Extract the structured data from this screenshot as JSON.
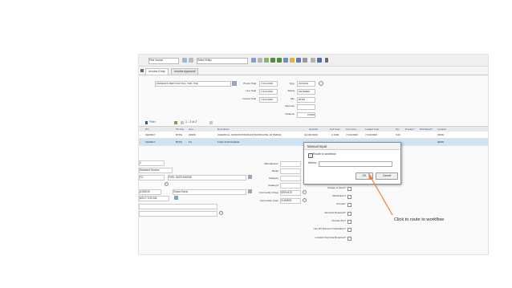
{
  "toolbar": {
    "record_selector_placeholder": "Find Invoice",
    "second_selector_placeholder": "Select Entity"
  },
  "tabs": [
    {
      "label": "Invoice Entry"
    },
    {
      "label": "Invoice Approval"
    }
  ],
  "header": {
    "vendor_name": "PAXMAN'S MRP FOR TDA, TDB, TDE",
    "pretax_total_label": "Pretax Total",
    "pretax_total": "7,612.0000",
    "line_total_label": "Line Total",
    "line_total": "7,612.0000",
    "invoice_total_label": "Invoice Total",
    "invoice_total": "7,612.0000",
    "type_label": "Type",
    "type_value": "INVOICE",
    "status_label": "Status",
    "status_value": "ENTERED",
    "site_label": "Site",
    "site_value": "BTPE",
    "discount_label": "Discount",
    "variance_label": "Variance",
    "variance_value": "0.0000"
  },
  "grid": {
    "filter_label": "Filter",
    "pager": "1 - 2 of 2",
    "columns": [
      "PO",
      "PO Site",
      "Item",
      "Description",
      "Quantity",
      "Unit Cost",
      "Line Cost",
      "Loaded Cost",
      "Tax",
      "Prorate?",
      "Distributed?",
      "Location"
    ],
    "rows": [
      {
        "po": "CE00017",
        "site": "BTPE",
        "item": "ZF999",
        "desc": "CHEMICAL, MONOPOTASSIUM PHOSPHATE, 22 PERCE",
        "qty": "40,000.0000",
        "unit": "0.1900",
        "line": "7,040.0000",
        "loaded": "7,040.0000",
        "tax": "0.00",
        "loc": "00000"
      },
      {
        "po": "CE00017",
        "site": "BTPE",
        "item": "FG",
        "desc": "FUEL SURCHARGE",
        "qty": "1.0000",
        "unit": "572.0000",
        "line": "572.0000",
        "loaded": "572.0000",
        "tax": "0.00",
        "loc": "00000"
      }
    ]
  },
  "detail": {
    "line_value": "2",
    "line_type": "Standard Service",
    "item_code": "FG",
    "item_desc": "FUEL SURCHARGE",
    "person_code": "A190019",
    "person_name": "Shane Davis",
    "entered_date": "8/3/17 9:20 AM",
    "manufacturer_label": "Manufacturer",
    "model_label": "Model",
    "category_label": "Category",
    "catalog_label": "Catalog #",
    "commodity_group_label": "Commodity Group",
    "commodity_group_value": "SERVICE",
    "commodity_code_label": "Commodity Code",
    "commodity_code_value": "CHARGE",
    "charge_to_store_label": "Charge to Store?",
    "distribution_label": "Distribution?",
    "prorate_label": "Prorate?",
    "receipts_label": "Receipts Required?",
    "prorate_svc_label": "Prorate Svc?",
    "use_po_discount_label": "Use PO Discount Calculation?",
    "location_approval_label": "Location Approval Required?"
  },
  "modal": {
    "title": "Manual Input",
    "checkbox_label": "Route to workflow",
    "memo_label": "Memo:",
    "ok_label": "OK",
    "cancel_label": "Cancel"
  },
  "annotation": {
    "text": "Click to route to workflow",
    "color": "#e8823a"
  }
}
